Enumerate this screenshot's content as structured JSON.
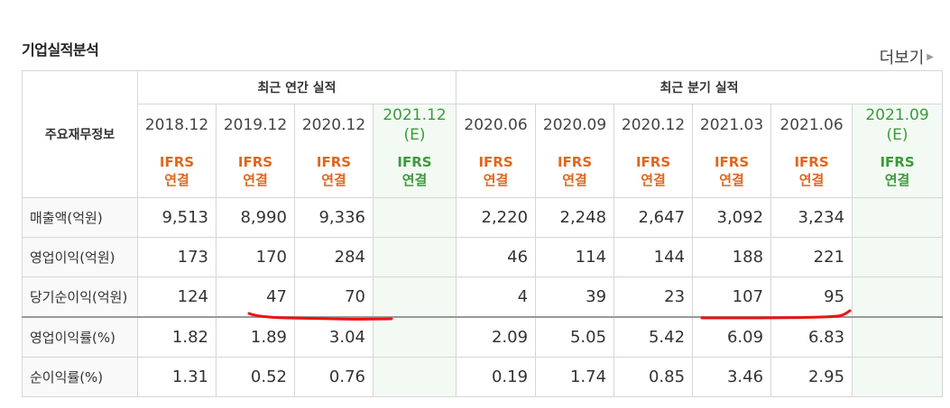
{
  "section": {
    "title": "기업실적분석",
    "more_label": "더보기"
  },
  "table": {
    "label_header": "주요재무정보",
    "annual_header": "최근 연간 실적",
    "quarter_header": "최근 분기 실적",
    "annual_periods": [
      {
        "line1": "2018.12",
        "line2": "",
        "basis1": "IFRS",
        "basis2": "연결"
      },
      {
        "line1": "2019.12",
        "line2": "",
        "basis1": "IFRS",
        "basis2": "연결"
      },
      {
        "line1": "2020.12",
        "line2": "",
        "basis1": "IFRS",
        "basis2": "연결"
      },
      {
        "line1": "2021.12",
        "line2": "(E)",
        "basis1": "IFRS",
        "basis2": "연결"
      }
    ],
    "quarter_periods": [
      {
        "line1": "2020.06",
        "line2": "",
        "basis1": "IFRS",
        "basis2": "연결"
      },
      {
        "line1": "2020.09",
        "line2": "",
        "basis1": "IFRS",
        "basis2": "연결"
      },
      {
        "line1": "2020.12",
        "line2": "",
        "basis1": "IFRS",
        "basis2": "연결"
      },
      {
        "line1": "2021.03",
        "line2": "",
        "basis1": "IFRS",
        "basis2": "연결"
      },
      {
        "line1": "2021.06",
        "line2": "",
        "basis1": "IFRS",
        "basis2": "연결"
      },
      {
        "line1": "2021.09",
        "line2": "(E)",
        "basis1": "IFRS",
        "basis2": "연결"
      }
    ],
    "rows": [
      {
        "label": "매출액(억원)",
        "annual": [
          "9,513",
          "8,990",
          "9,336",
          ""
        ],
        "quarter": [
          "2,220",
          "2,248",
          "2,647",
          "3,092",
          "3,234",
          ""
        ]
      },
      {
        "label": "영업이익(억원)",
        "annual": [
          "173",
          "170",
          "284",
          ""
        ],
        "quarter": [
          "46",
          "114",
          "144",
          "188",
          "221",
          ""
        ]
      },
      {
        "label": "당기순이익(억원)",
        "annual": [
          "124",
          "47",
          "70",
          ""
        ],
        "quarter": [
          "4",
          "39",
          "23",
          "107",
          "95",
          ""
        ]
      },
      {
        "label": "영업이익률(%)",
        "annual": [
          "1.82",
          "1.89",
          "3.04",
          ""
        ],
        "quarter": [
          "2.09",
          "5.05",
          "5.42",
          "6.09",
          "6.83",
          ""
        ]
      },
      {
        "label": "순이익률(%)",
        "annual": [
          "1.31",
          "0.52",
          "0.76",
          ""
        ],
        "quarter": [
          "0.19",
          "1.74",
          "0.85",
          "3.46",
          "2.95",
          ""
        ]
      }
    ]
  },
  "colors": {
    "basis": "#e0661f",
    "estimate": "#3c9a3c",
    "underline": "#ee1111"
  }
}
